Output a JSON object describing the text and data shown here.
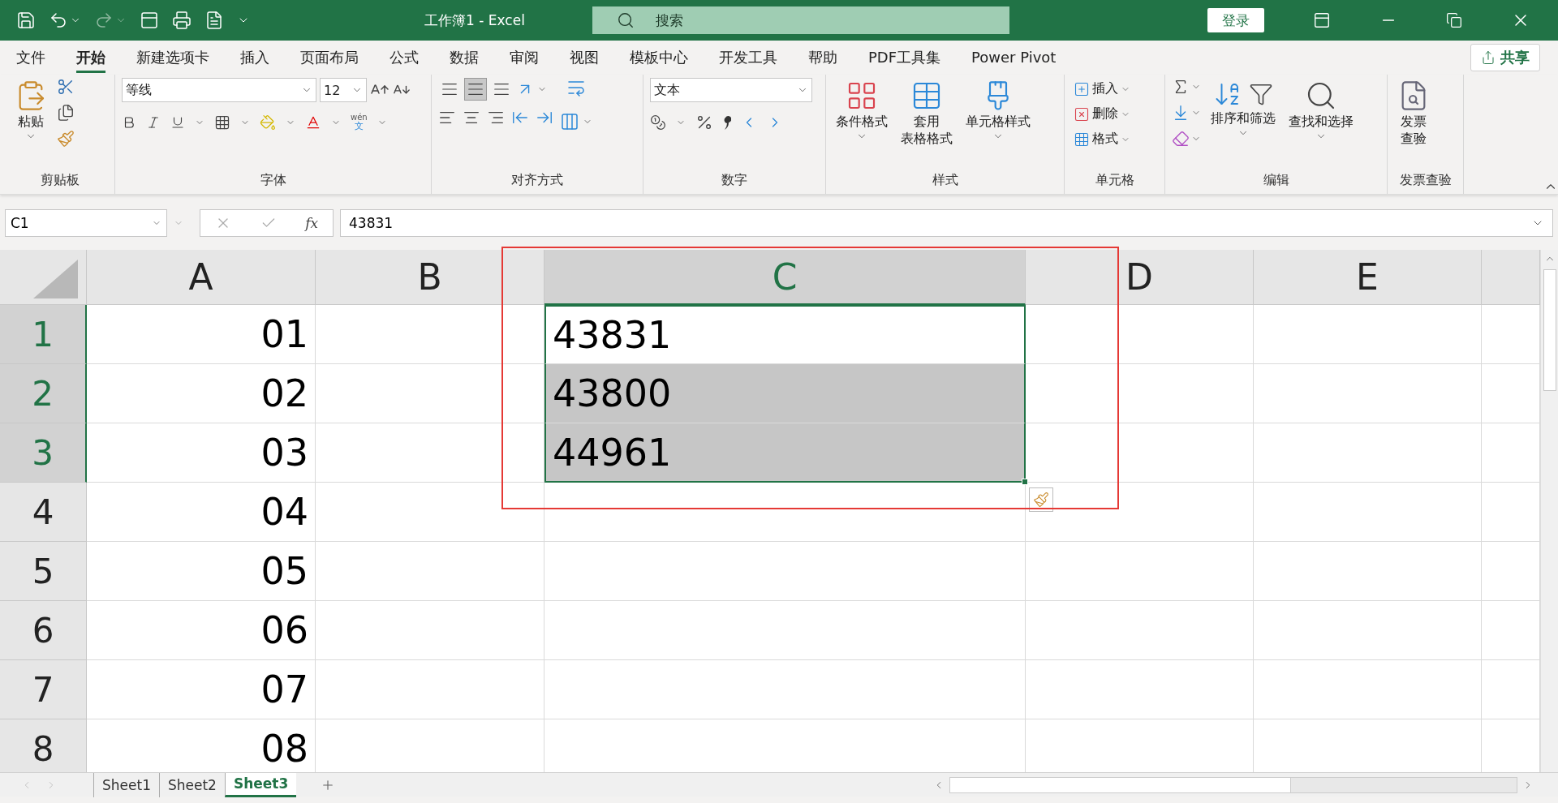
{
  "window": {
    "title": "工作簿1  -  Excel"
  },
  "search": {
    "placeholder": "搜索"
  },
  "login_button": "登录",
  "menu_tabs": [
    {
      "label": "文件",
      "selected": false
    },
    {
      "label": "开始",
      "selected": true
    },
    {
      "label": "新建选项卡",
      "selected": false
    },
    {
      "label": "插入",
      "selected": false
    },
    {
      "label": "页面布局",
      "selected": false
    },
    {
      "label": "公式",
      "selected": false
    },
    {
      "label": "数据",
      "selected": false
    },
    {
      "label": "审阅",
      "selected": false
    },
    {
      "label": "视图",
      "selected": false
    },
    {
      "label": "模板中心",
      "selected": false
    },
    {
      "label": "开发工具",
      "selected": false
    },
    {
      "label": "帮助",
      "selected": false
    },
    {
      "label": "PDF工具集",
      "selected": false
    },
    {
      "label": "Power Pivot",
      "selected": false
    }
  ],
  "share_button": "共享",
  "ribbon": {
    "clipboard": {
      "paste": "粘贴",
      "group": "剪贴板"
    },
    "font": {
      "font_name": "等线",
      "font_size": "12",
      "phonetic_top": "wén",
      "phonetic_bottom": "文",
      "group": "字体"
    },
    "alignment": {
      "middle_align_selected": true,
      "group": "对齐方式"
    },
    "number": {
      "format": "文本",
      "group": "数字"
    },
    "styles": {
      "conditional": "条件格式",
      "table_format_line1": "套用",
      "table_format_line2": "表格格式",
      "cell_styles": "单元格样式",
      "group": "样式"
    },
    "cells": {
      "insert": "插入",
      "delete": "删除",
      "format": "格式",
      "group": "单元格"
    },
    "editing": {
      "sort_filter": "排序和筛选",
      "find_select": "查找和选择",
      "group": "编辑"
    },
    "invoice": {
      "line1": "发票",
      "line2": "查验",
      "group": "发票查验"
    }
  },
  "formula_bar": {
    "name_box": "C1",
    "function_label": "fx",
    "value": "43831"
  },
  "sheet": {
    "columns": [
      {
        "label": "A",
        "selected": false
      },
      {
        "label": "B",
        "selected": false
      },
      {
        "label": "C",
        "selected": true
      },
      {
        "label": "D",
        "selected": false
      },
      {
        "label": "E",
        "selected": false
      }
    ],
    "rows": [
      {
        "header": "1",
        "selected": true,
        "column_a": "01",
        "column_c": {
          "value": "43831",
          "selected": true,
          "active": true
        }
      },
      {
        "header": "2",
        "selected": true,
        "column_a": "02",
        "column_c": {
          "value": "43800",
          "selected": true,
          "active": false
        }
      },
      {
        "header": "3",
        "selected": true,
        "column_a": "03",
        "column_c": {
          "value": "44961",
          "selected": true,
          "active": false
        }
      },
      {
        "header": "4",
        "selected": false,
        "column_a": "04"
      },
      {
        "header": "5",
        "selected": false,
        "column_a": "05"
      },
      {
        "header": "6",
        "selected": false,
        "column_a": "06"
      },
      {
        "header": "7",
        "selected": false,
        "column_a": "07"
      },
      {
        "header": "8",
        "selected": false,
        "column_a": "08"
      }
    ]
  },
  "highlight_frame": true,
  "sheet_tabs": [
    {
      "label": "Sheet1",
      "selected": false
    },
    {
      "label": "Sheet2",
      "selected": false
    },
    {
      "label": "Sheet3",
      "selected": true
    }
  ]
}
